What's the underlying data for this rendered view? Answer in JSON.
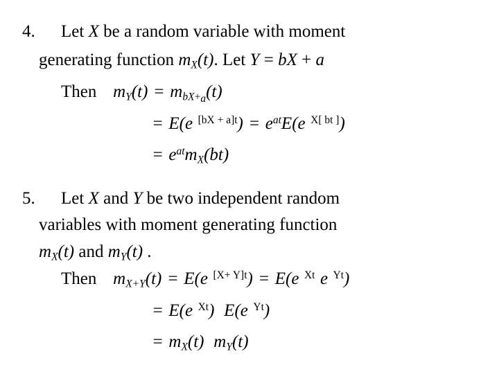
{
  "slide": {
    "background_color": "#ffffff",
    "text_color": "#000000",
    "topic": "Moment generating functions"
  },
  "items": [
    {
      "number": "4.",
      "text_lines": [
        "Let X be a random variable with moment",
        "generating function mX(t). Let Y = bX + a"
      ],
      "equations": [
        "Then  mY(t) = mbX+ a(t)",
        "= E(e [bX + a]t) = eatE(e X[ bt ])",
        "= eat mX (bt)"
      ]
    },
    {
      "number": "5.",
      "text_lines": [
        "Let X and Y be two independent random",
        "variables with moment generating function",
        "mX(t) and mY(t) ."
      ],
      "equations": [
        "Then  mX+Y(t) = E(e [X+ Y]t) = E(e Xt e Yt)",
        "= E(e Xt) E(e Yt)",
        "= mX (t) mY (t)"
      ]
    }
  ],
  "tokens": {
    "item4_line1_pre": "Let ",
    "item4_line1_X": "X",
    "item4_line1_post": " be a random variable with moment",
    "item4_line2_pre": "generating function ",
    "item4_line2_m": "m",
    "item4_line2_sub": "X",
    "item4_line2_mid": "(t)",
    "item4_line2_let": ". Let ",
    "item4_line2_Y": "Y",
    "item4_line2_eq": " = ",
    "item4_line2_b": "b",
    "item4_line2_X2": "X",
    "item4_line2_plus": " + ",
    "item4_line2_a": "a",
    "then_word": "Then",
    "m_letter": "m",
    "t_paren": "(t)",
    "equals": "=",
    "sub_Y": "Y",
    "sub_X": "X",
    "sub_bXa_b": "bX",
    "sub_bXa_plus": "+",
    "sub_bXa_a": "a",
    "E_letter": "E",
    "e_letter": "e",
    "sup_bXat": "[bX + a]t",
    "sup_at": "at",
    "sup_Xbt": "X[ bt ]",
    "bt_arg": "(bt)",
    "item5_line1_pre": "Let ",
    "item5_line1_X": "X",
    "item5_line1_mid": " and ",
    "item5_line1_Y": "Y",
    "item5_line1_post": " be two independent random",
    "item5_line2": "variables with moment generating function",
    "item5_line3_and": " and ",
    "item5_line3_end": " .",
    "sub_XplusY_X": "X+",
    "sub_XplusY_Y": "Y",
    "sup_XYt": "[X+ Y]t",
    "sup_Xt": "Xt",
    "sup_Yt": "Yt",
    "t_arg": "(t)"
  }
}
